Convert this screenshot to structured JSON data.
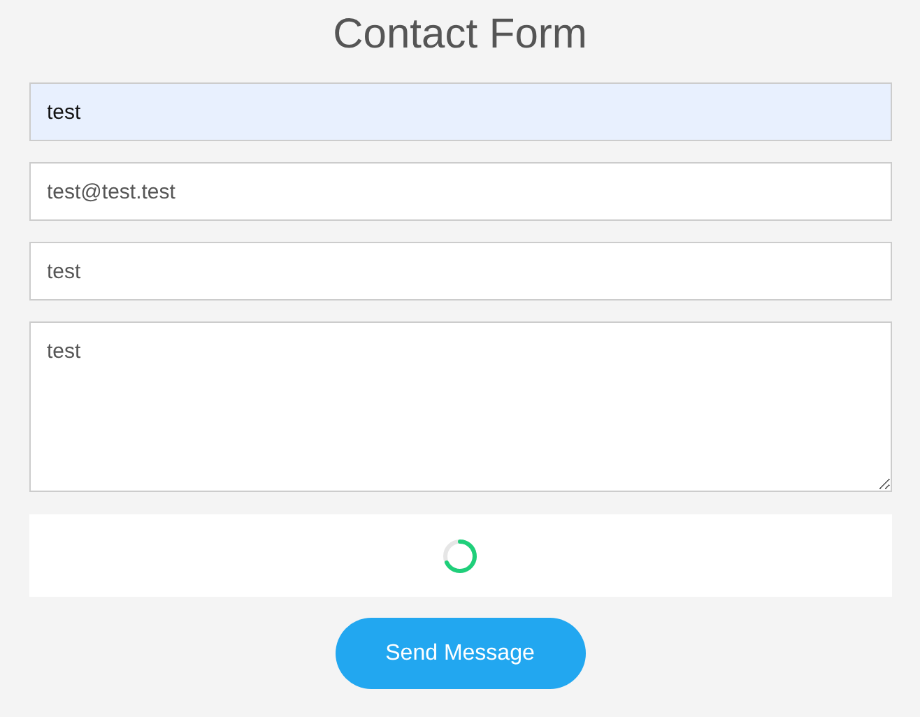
{
  "title": "Contact Form",
  "fields": [
    {
      "kind": "input",
      "value": "test",
      "highlighted": true
    },
    {
      "kind": "input",
      "value": "test@test.test",
      "highlighted": false
    },
    {
      "kind": "input",
      "value": "test",
      "highlighted": false
    },
    {
      "kind": "textarea",
      "value": "test",
      "highlighted": false
    }
  ],
  "captcha": {
    "loading": true
  },
  "submit_button": "Send Message"
}
